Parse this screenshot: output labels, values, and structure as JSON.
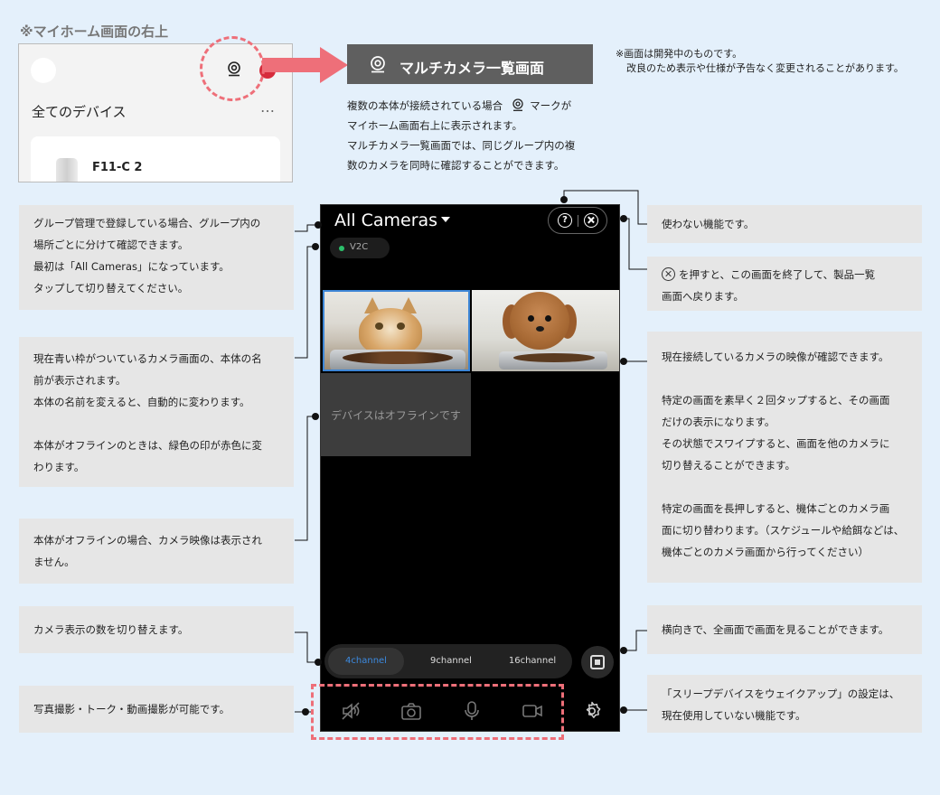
{
  "inset": {
    "title": "※マイホーム画面の右上",
    "section_label": "全てのデバイス",
    "more": "…",
    "device_name": "F11-C 2"
  },
  "header_box": {
    "title": "マルチカメラ一覧画面"
  },
  "intro": {
    "line1_a": "複数の本体が接続されている場合",
    "line1_b": "マークが",
    "line2": "マイホーム画面右上に表示されます。",
    "line3": "マルチカメラ一覧画面では、同じグループ内の複",
    "line4": "数のカメラを同時に確認することができます。"
  },
  "notice": {
    "line1": "※画面は開発中のものです。",
    "line2": "改良のため表示や仕様が予告なく変更されることがあります。"
  },
  "phone": {
    "title": "All Cameras",
    "help": "?",
    "device_chip": "V2C",
    "offline_text": "デバイスはオフラインです",
    "channels": [
      "4channel",
      "9channel",
      "16channel"
    ]
  },
  "callouts": {
    "group": [
      "グループ管理で登録している場合、グループ内の",
      "場所ごとに分けて確認できます。",
      "最初は「All Cameras」になっています。",
      "タップして切り替えてください。"
    ],
    "name": [
      "現在青い枠がついているカメラ画面の、本体の名",
      "前が表示されます。",
      "本体の名前を変えると、自動的に変わります。",
      "",
      "本体がオフラインのときは、緑色の印が赤色に変",
      "わります。"
    ],
    "offline": [
      "本体がオフラインの場合、カメラ映像は表示され",
      "ません。"
    ],
    "channels": [
      "カメラ表示の数を切り替えます。"
    ],
    "toolbar": [
      "写真撮影・トーク・動画撮影が可能です。"
    ],
    "help": [
      "使わない機能です。"
    ],
    "close_a": "を押すと、この画面を終了して、製品一覧",
    "close_b": "画面へ戻ります。",
    "feed": [
      "現在接続しているカメラの映像が確認できます。",
      "",
      "特定の画面を素早く２回タップすると、その画面",
      "だけの表示になります。",
      "その状態でスワイプすると、画面を他のカメラに",
      "切り替えることができます。",
      "",
      "特定の画面を長押しすると、機体ごとのカメラ画",
      "面に切り替わります。（スケジュールや給餌などは、",
      "機体ごとのカメラ画面から行ってください）"
    ],
    "fullscreen": [
      "横向きで、全画面で画面を見ることができます。"
    ],
    "settings": [
      "「スリープデバイスをウェイクアップ」の設定は、",
      "現在使用していない機能です。"
    ]
  },
  "colors": {
    "accent_pink": "#ee6f79",
    "active_blue": "#3c8ae0",
    "online_green": "#2cbf6b",
    "badge_red": "#d62c3c"
  }
}
